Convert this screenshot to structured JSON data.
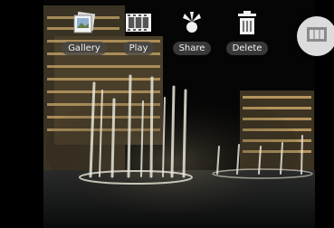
{
  "toolbar": {
    "items": [
      {
        "label": "Gallery",
        "icon": "gallery-icon"
      },
      {
        "label": "Play",
        "icon": "film-strip-icon"
      },
      {
        "label": "Share",
        "icon": "share-icon"
      },
      {
        "label": "Delete",
        "icon": "trash-icon"
      }
    ]
  },
  "side_button": {
    "icon": "film-strip-icon"
  },
  "photo": {
    "subject": "night-fountain-scene"
  }
}
